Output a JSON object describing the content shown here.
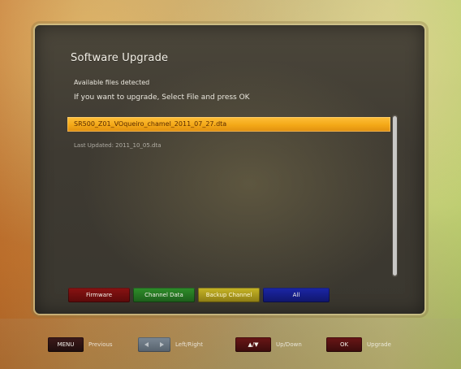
{
  "screen": {
    "title": "Software Upgrade"
  },
  "info": {
    "line1": "Available files detected",
    "line2": "If you want to upgrade, Select File and press OK"
  },
  "files": [
    {
      "name": "SR500_Z01_VOqueiro_chamel_2011_07_27.dta",
      "selected": true
    },
    {
      "name": "Last Updated: 2011_10_05.dta",
      "selected": false
    }
  ],
  "buttons": {
    "red": "Firmware",
    "green": "Channel Data",
    "yellow": "Backup Channel",
    "blue": "All"
  },
  "footer_hints": [
    {
      "key": "MENU",
      "label": "Previous",
      "key_style": "dark"
    },
    {
      "key": "",
      "label": "Left/Right",
      "key_style": "slate",
      "icon": "left-right-arrows-icon"
    },
    {
      "key": "▲/▼",
      "label": "Up/Down",
      "key_style": "maroon"
    },
    {
      "key": "OK",
      "label": "Upgrade",
      "key_style": "maroon"
    }
  ],
  "colors": {
    "selection_orange": "#F3A817",
    "red_button": "#7A1010",
    "green_button": "#2E8F2A",
    "yellow_button": "#C8B726",
    "blue_button": "#1B26A8"
  }
}
